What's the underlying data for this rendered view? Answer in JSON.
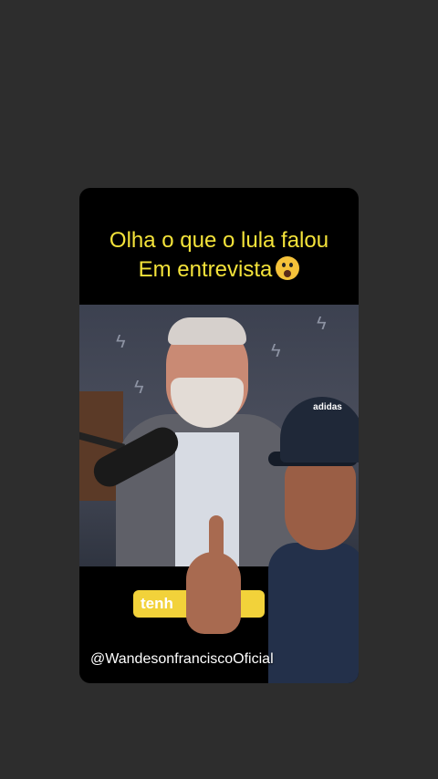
{
  "post": {
    "title_line1": "Olha o que o lula falou",
    "title_line2": "Em entrevista",
    "title_emoji": "face-screaming-in-fear",
    "caption_partial": "tenh",
    "handle": "@WandesonfranciscoOficial",
    "cap_logo_text": "adidas"
  }
}
